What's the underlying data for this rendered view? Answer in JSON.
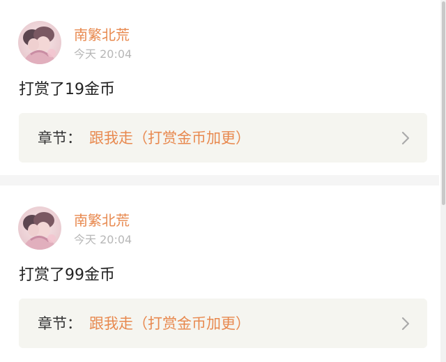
{
  "colors": {
    "accent": "#e8894f",
    "text": "#222222",
    "muted": "#b7b7b7",
    "chapter_bg": "#f5f5f0"
  },
  "feed": [
    {
      "user": "南繁北荒",
      "time": "今天 20:04",
      "message": "打赏了19金币",
      "chapter_label": "章节：",
      "chapter_title": "跟我走（打赏金币加更）",
      "chevron_icon": "chevron-right-icon"
    },
    {
      "user": "南繁北荒",
      "time": "今天 20:04",
      "message": "打赏了99金币",
      "chapter_label": "章节：",
      "chapter_title": "跟我走（打赏金币加更）",
      "chevron_icon": "chevron-right-icon"
    }
  ]
}
